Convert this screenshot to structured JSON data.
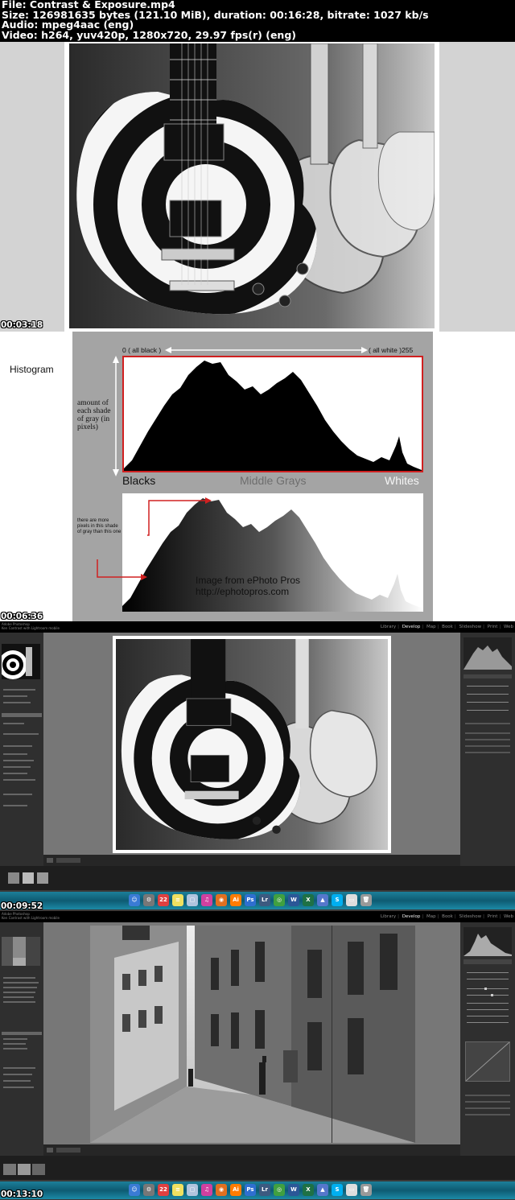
{
  "info": {
    "file": "File: Contrast & Exposure.mp4",
    "size": "Size: 126981635 bytes (121.10 MiB), duration: 00:16:28, bitrate: 1027 kb/s",
    "audio": "Audio: mpeg4aac (eng)",
    "video": "Video: h264, yuv420p, 1280x720, 29.97 fps(r) (eng)"
  },
  "timestamps": [
    "00:03:18",
    "00:06:36",
    "00:09:52",
    "00:13:10"
  ],
  "slide": {
    "title": "Histogram",
    "range_left": "0 ( all black )",
    "range_right": "( all white )255",
    "ylabel": "amount of each shade of gray (in pixels)",
    "label_blacks": "Blacks",
    "label_mids": "Middle Grays",
    "label_whites": "Whites",
    "note": "there are more pixels in this shade of gray than this one",
    "credit_line1": "Image from ePhoto Pros",
    "credit_line2": "http://ephotopros.com"
  },
  "lightroom": {
    "modules": [
      "Library",
      "Develop",
      "Map",
      "Book",
      "Slideshow",
      "Print",
      "Web"
    ],
    "active_module": "Develop",
    "catalog_line1": "Adobe Photoshop",
    "catalog_line2": "Ken Contrast with Lightroom mobile"
  },
  "dock": {
    "icons": [
      {
        "name": "finder-icon",
        "glyph": "☺",
        "color": "#3a7bd5"
      },
      {
        "name": "system-preferences-icon",
        "glyph": "⚙",
        "color": "#777777"
      },
      {
        "name": "calendar-icon",
        "glyph": "22",
        "color": "#e04040"
      },
      {
        "name": "notes-icon",
        "glyph": "≡",
        "color": "#f0e060"
      },
      {
        "name": "preview-icon",
        "glyph": "▢",
        "color": "#b0c4de"
      },
      {
        "name": "itunes-icon",
        "glyph": "♫",
        "color": "#d040a0"
      },
      {
        "name": "firefox-icon",
        "glyph": "◉",
        "color": "#e07020"
      },
      {
        "name": "illustrator-icon",
        "glyph": "Ai",
        "color": "#ff7c00"
      },
      {
        "name": "photoshop-icon",
        "glyph": "Ps",
        "color": "#2f6fd0"
      },
      {
        "name": "lightroom-icon",
        "glyph": "Lr",
        "color": "#3d5a80"
      },
      {
        "name": "chrome-icon",
        "glyph": "◎",
        "color": "#40a040"
      },
      {
        "name": "word-icon",
        "glyph": "W",
        "color": "#2b5797"
      },
      {
        "name": "excel-icon",
        "glyph": "X",
        "color": "#1e7145"
      },
      {
        "name": "app-icon",
        "glyph": "▲",
        "color": "#5577cc"
      },
      {
        "name": "skype-icon",
        "glyph": "S",
        "color": "#00aff0"
      },
      {
        "name": "documents-icon",
        "glyph": "▭",
        "color": "#dddddd"
      },
      {
        "name": "trash-icon",
        "glyph": "🗑",
        "color": "#999999"
      }
    ]
  },
  "colors": {
    "histogram_border": "#d02020",
    "annotation_arrow": "#d02020",
    "dock": "#1c7f9a"
  }
}
